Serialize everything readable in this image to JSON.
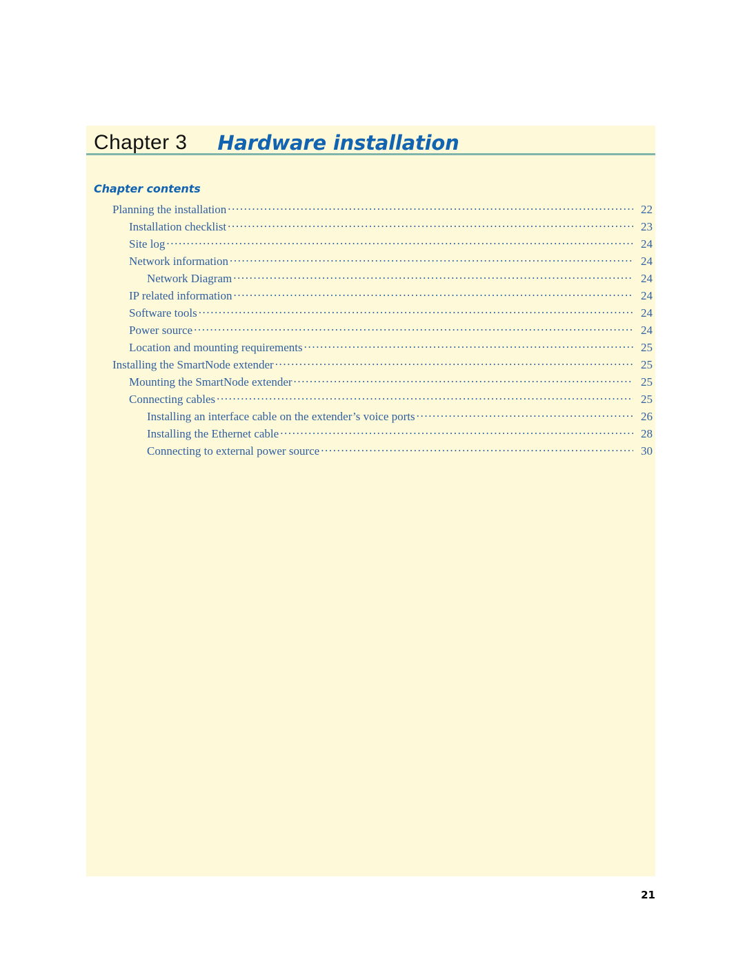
{
  "page": {
    "background_color": "#fdf9d9",
    "rule_color": "#7fb5aa",
    "title_color": "#1263b0",
    "toc_color": "#2f5f9f",
    "page_number": "21"
  },
  "header": {
    "chapter_label": "Chapter 3",
    "chapter_title": "Hardware installation"
  },
  "contents": {
    "heading": "Chapter contents",
    "entries": [
      {
        "label": "Planning the installation",
        "page": "22",
        "level": 0
      },
      {
        "label": "Installation checklist",
        "page": "23",
        "level": 1
      },
      {
        "label": "Site log",
        "page": "24",
        "level": 1
      },
      {
        "label": "Network information",
        "page": "24",
        "level": 1
      },
      {
        "label": "Network Diagram",
        "page": "24",
        "level": 2
      },
      {
        "label": "IP related information",
        "page": "24",
        "level": 1
      },
      {
        "label": "Software tools",
        "page": "24",
        "level": 1
      },
      {
        "label": "Power source",
        "page": "24",
        "level": 1
      },
      {
        "label": "Location and mounting requirements",
        "page": "25",
        "level": 1
      },
      {
        "label": "Installing the SmartNode extender",
        "page": "25",
        "level": 0
      },
      {
        "label": "Mounting the SmartNode extender",
        "page": "25",
        "level": 1
      },
      {
        "label": "Connecting cables",
        "page": "25",
        "level": 1
      },
      {
        "label": "Installing an interface cable on the extender’s voice ports",
        "page": "26",
        "level": 2
      },
      {
        "label": "Installing the Ethernet cable",
        "page": "28",
        "level": 2
      },
      {
        "label": "Connecting to external power source",
        "page": "30",
        "level": 2
      }
    ]
  }
}
